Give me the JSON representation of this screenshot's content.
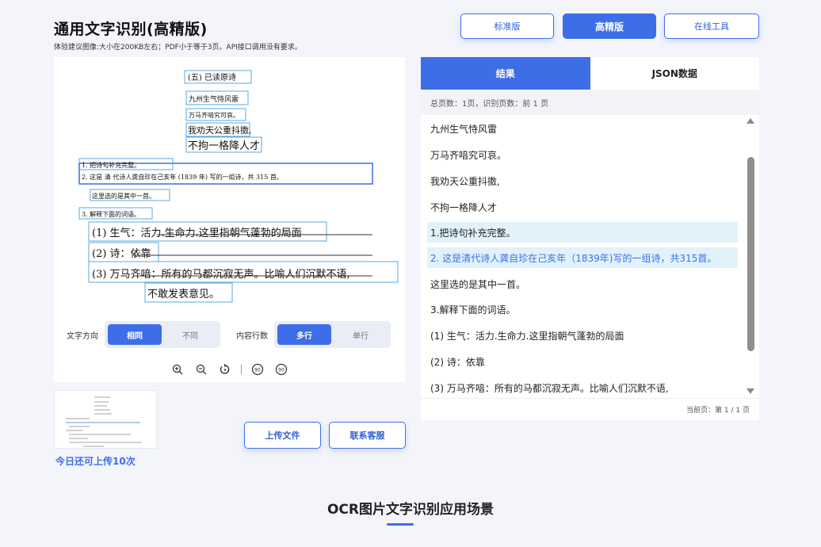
{
  "header": {
    "title": "通用文字识别(高精版)",
    "subtitle": "体验建议图像:大小在200KB左右；PDF小于等于3页。API接口调用没有要求。"
  },
  "modes": {
    "standard": "标准版",
    "high": "高精版",
    "online": "在线工具"
  },
  "document": {
    "lines": [
      "(五)  已读原诗",
      "九州生气恃风雷",
      "万马齐喑究可哀。",
      "我劝天公重抖擞,",
      "不拘一格降人才",
      "1. 把诗句补充完整。",
      "2. 这是   清   代诗人龚自珍在己亥年 (1839 年) 写的一组诗，共  315  首。",
      "这里选的是其中一首。",
      "3. 解释下面的词语。",
      "(1) 生气：活力.生命力.这里指朝气蓬勃的局面",
      "(2) 诗：依靠",
      "(3) 万马齐喑：所有的马都沉寂无声。比喻人们沉默不语,",
      "不敢发表意见。"
    ]
  },
  "controls": {
    "direction_label": "文字方向",
    "direction_options": [
      "相同",
      "不同"
    ],
    "direction_selected": "相同",
    "lines_label": "内容行数",
    "lines_options": [
      "多行",
      "单行"
    ],
    "lines_selected": "多行"
  },
  "tools": [
    "zoom-in-icon",
    "zoom-out-icon",
    "rotate-icon",
    "rotate-left-90-icon",
    "rotate-right-90-icon"
  ],
  "tool_labels": {
    "rotate_left": "90",
    "rotate_right": "90"
  },
  "upload": {
    "count_text": "今日还可上传10次",
    "upload_label": "上传文件",
    "contact_label": "联系客服"
  },
  "results": {
    "tabs": [
      "结果",
      "JSON数据"
    ],
    "summary": "总页数：1页，识别页数：前 1 页",
    "lines": [
      "九州生气恃风雷",
      "万马齐喑究可哀。",
      "我劝天公重抖擞,",
      "不拘一格降人才",
      "1.把诗句补充完整。",
      "2. 这是清代诗人龚自珍在己亥年（1839年)写的一组诗，共315首。",
      "这里选的是其中一首。",
      "3.解释下面的词语。",
      "(1) 生气：活力.生命力.这里指朝气蓬勃的局面",
      "(2) 诗：依靠",
      "(3) 万马齐喑：所有的马都沉寂无声。比喻人们沉默不语,"
    ],
    "pager": "当前页：第 1 / 1 页"
  },
  "section": {
    "title": "OCR图片文字识别应用场景"
  },
  "colors": {
    "accent": "#3d6ee8",
    "highlight": "#e2f2fb",
    "box": "#5aa8e0"
  }
}
